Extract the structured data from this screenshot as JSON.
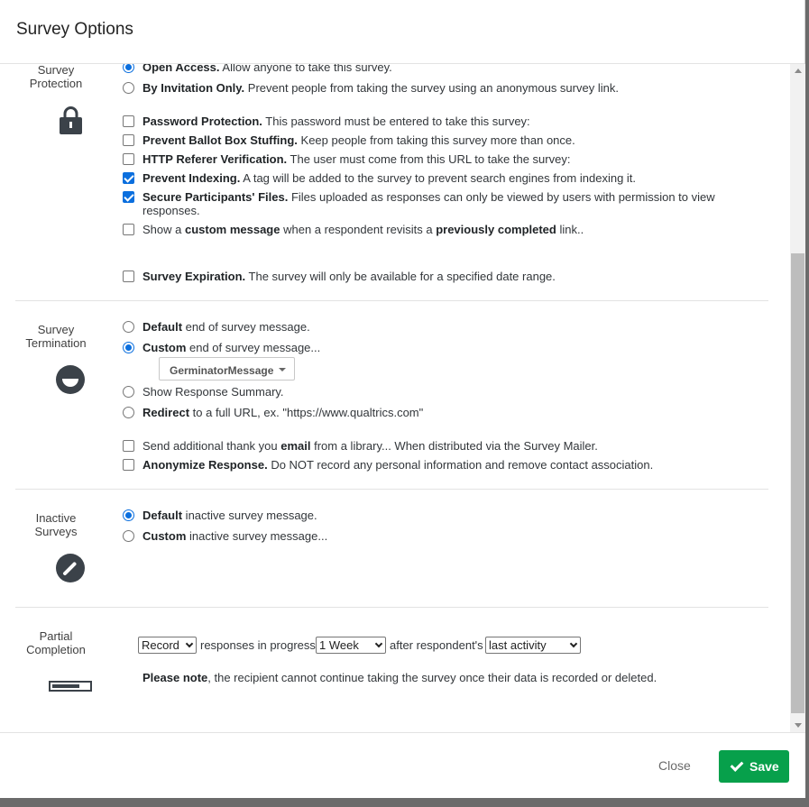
{
  "modal": {
    "title": "Survey Options"
  },
  "protection": {
    "label": "Survey Protection",
    "icon": "lock-icon",
    "open_access": {
      "bold": "Open Access.",
      "text": " Allow anyone to take this survey.",
      "selected": true
    },
    "invitation_only": {
      "bold": "By Invitation Only.",
      "text": " Prevent people from taking the survey using an anonymous survey link.",
      "selected": false
    },
    "password": {
      "bold": "Password Protection.",
      "text": " This password must be entered to take this survey:",
      "checked": false
    },
    "ballot": {
      "bold": "Prevent Ballot Box Stuffing.",
      "text": " Keep people from taking this survey more than once.",
      "checked": false
    },
    "referer": {
      "bold": "HTTP Referer Verification.",
      "text": " The user must come from this URL to take the survey:",
      "checked": false
    },
    "indexing": {
      "bold": "Prevent Indexing.",
      "text": " A tag will be added to the survey to prevent search engines from indexing it.",
      "checked": true
    },
    "secure_files": {
      "bold": "Secure Participants' Files.",
      "text_line1": " Files uploaded as responses can only be viewed by users with permission to view",
      "text_line2": "responses.",
      "checked": true
    },
    "custom_message": {
      "pre": "Show a ",
      "bold1": "custom message",
      "mid": " when a respondent revisits a ",
      "bold2": "previously completed",
      "post": " link..",
      "checked": false
    },
    "expiration": {
      "bold": "Survey Expiration.",
      "text": " The survey will only be available for a specified date range.",
      "checked": false
    }
  },
  "termination": {
    "label": "Survey Termination",
    "icon": "smile-icon",
    "default": {
      "bold": "Default",
      "text": " end of survey message.",
      "selected": false
    },
    "custom": {
      "bold": "Custom",
      "text": " end of survey message...",
      "selected": true
    },
    "message_dropdown": "GerminatorMessage",
    "summary": {
      "text": "Show Response Summary.",
      "selected": false
    },
    "redirect": {
      "bold": "Redirect",
      "text": " to a full URL, ex. \"https://www.qualtrics.com\"",
      "selected": false
    },
    "email": {
      "pre": "Send additional thank you ",
      "bold": "email",
      "post": " from a library... When distributed via the Survey Mailer.",
      "checked": false
    },
    "anonymize": {
      "bold": "Anonymize Response.",
      "text": " Do NOT record any personal information and remove contact association.",
      "checked": false
    }
  },
  "inactive": {
    "label": "Inactive Surveys",
    "icon": "pencil-icon",
    "default": {
      "bold": "Default",
      "text": " inactive survey message.",
      "selected": true
    },
    "custom": {
      "bold": "Custom",
      "text": " inactive survey message...",
      "selected": false
    }
  },
  "partial": {
    "label": "Partial Completion",
    "icon": "progress-bar-icon",
    "action_select": "Record",
    "text1": "responses in progress",
    "duration_select": "1 Week",
    "text2": "after respondent's",
    "basis_select": "last activity",
    "note_bold": "Please note",
    "note_text": ", the recipient cannot continue taking the survey once their data is recorded or deleted."
  },
  "footer": {
    "close_label": "Close",
    "save_label": "Save"
  },
  "colors": {
    "accent": "#0b6fde",
    "save": "#07a04b",
    "icon": "#3b4249"
  }
}
